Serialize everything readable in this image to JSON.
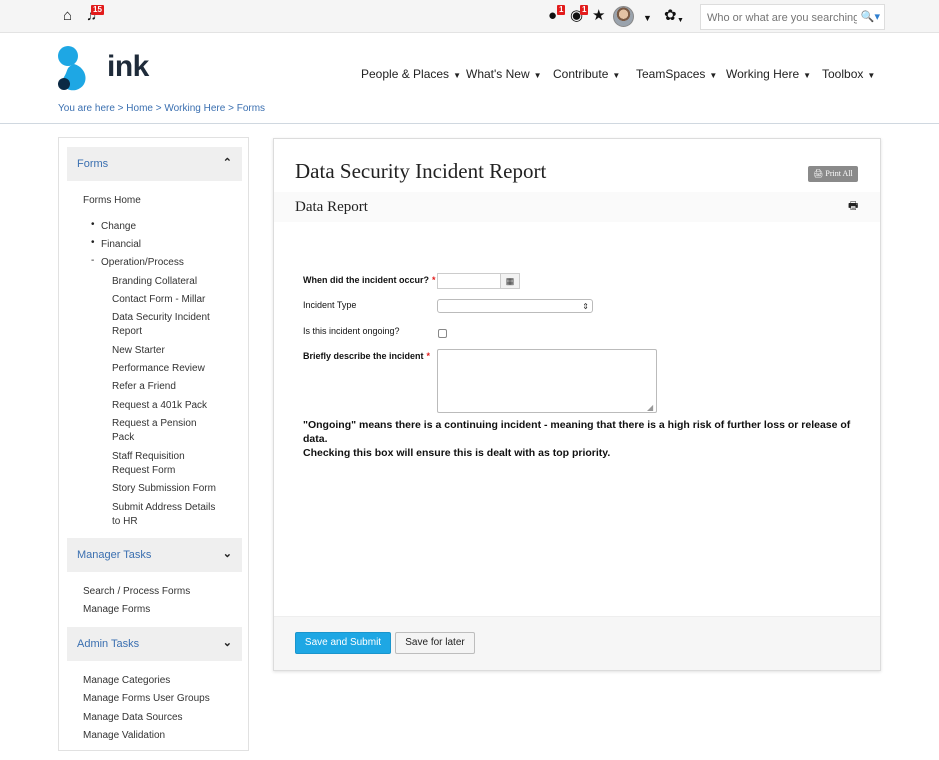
{
  "topbar": {
    "notifications_count": "15",
    "alerts_count": "1",
    "watch_count": "1",
    "search_placeholder": "Who or what are you searching f...",
    "icons": [
      "home-icon",
      "bell-icon",
      "alert-icon",
      "eye-icon",
      "star-icon",
      "avatar",
      "gear-icon",
      "search-icon"
    ]
  },
  "brand": {
    "name": "ink",
    "color": "#1ea7e4"
  },
  "nav": {
    "items": [
      "People & Places",
      "What's New",
      "Contribute",
      "TeamSpaces",
      "Working Here",
      "Toolbox"
    ]
  },
  "breadcrumb": "You are here > Home > Working Here > Forms",
  "sidebar": {
    "forms_header": "Forms",
    "forms_home": "Forms Home",
    "categories": [
      "Change",
      "Financial",
      "Operation/Process"
    ],
    "forms": [
      "Branding Collateral",
      "Contact Form - Millar",
      "Data Security Incident",
      "Report",
      "New Starter",
      "Performance Review",
      "Refer a Friend",
      "Request a 401k Pack",
      "Request a Pension",
      "Pack",
      "Staff Requisition",
      "Request Form",
      "Story Submission Form",
      "Submit Address Details",
      "to HR"
    ],
    "manager_header": "Manager Tasks",
    "manager_items": [
      "Search / Process Forms",
      "Manage Forms"
    ],
    "admin_header": "Admin Tasks",
    "admin_items": [
      "Manage Categories",
      "Manage Forms User Groups",
      "Manage Data Sources",
      "Manage Validation"
    ]
  },
  "form": {
    "title": "Data Security Incident Report",
    "print_all": "Print All",
    "section_title": "Data Report",
    "fields": {
      "date_label": "When did the incident occur?",
      "type_label": "Incident Type",
      "ongoing_label": "Is this incident ongoing?",
      "describe_label": "Briefly describe the incident",
      "required_mark": "*"
    },
    "note_line1": "\"Ongoing\" means there is a continuing incident - meaning that there is a high risk of further loss or release of data.",
    "note_line2": "Checking this box will ensure this is dealt with as top priority.",
    "submit_label": "Save and Submit",
    "save_later_label": "Save for later"
  }
}
